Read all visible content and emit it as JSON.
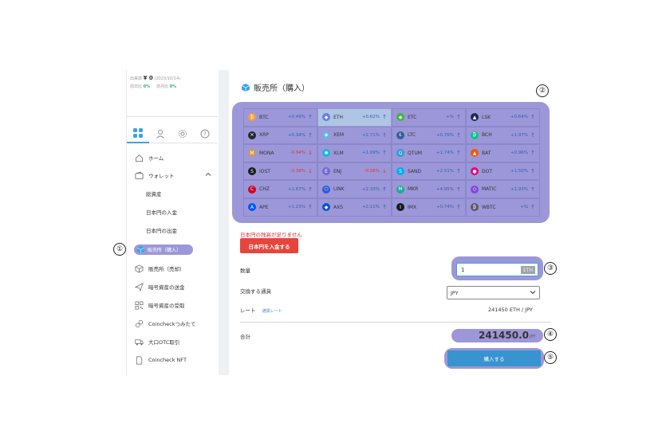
{
  "summary": {
    "label": "出来高",
    "amount": "¥ 0",
    "date": "(2023/10/14)",
    "change_label_1": "前日比",
    "change_value_1": "0%",
    "change_label_2": "前月比",
    "change_value_2": "0%"
  },
  "tabs": [
    "grid",
    "user",
    "gear",
    "help"
  ],
  "sidebar": {
    "home": "ホーム",
    "wallet": "ウォレット",
    "sub_total": "総資産",
    "sub_deposit": "日本円の入金",
    "sub_withdraw": "日本円の出金",
    "buy": "販売所（購入）",
    "sell": "販売所（売却）",
    "send": "暗号資産の送金",
    "receive": "暗号資産の受取",
    "tsumitate": "Coincheckつみたて",
    "otc": "大口OTC取引",
    "nft": "Coincheck NFT"
  },
  "markers": [
    "①",
    "②",
    "③",
    "④",
    "⑤"
  ],
  "main": {
    "title": "販売所（購入）",
    "coins": [
      {
        "sym": "BTC",
        "pct": "+0.49%",
        "dir": "up",
        "color": "#f0a03a",
        "glyph": "₿"
      },
      {
        "sym": "ETH",
        "pct": "+0.62%",
        "dir": "up",
        "color": "#627eea",
        "glyph": "◆"
      },
      {
        "sym": "ETC",
        "pct": "+%",
        "dir": "up",
        "color": "#3ab83a",
        "glyph": "◆"
      },
      {
        "sym": "LSK",
        "pct": "+0.64%",
        "dir": "up",
        "color": "#1a2a5a",
        "glyph": "▲"
      },
      {
        "sym": "XRP",
        "pct": "+0.34%",
        "dir": "up",
        "color": "#23292f",
        "glyph": "✕"
      },
      {
        "sym": "XEM",
        "pct": "+2.71%",
        "dir": "up",
        "color": "#67b2e8",
        "glyph": "◈"
      },
      {
        "sym": "LTC",
        "pct": "+0.76%",
        "dir": "up",
        "color": "#345d9d",
        "glyph": "Ł"
      },
      {
        "sym": "BCH",
        "pct": "+1.97%",
        "dir": "up",
        "color": "#0ac18e",
        "glyph": "₿"
      },
      {
        "sym": "MONA",
        "pct": "-0.94%",
        "dir": "down",
        "color": "#c99a5b",
        "glyph": "M"
      },
      {
        "sym": "XLM",
        "pct": "+1.09%",
        "dir": "up",
        "color": "#14b6e7",
        "glyph": "✺"
      },
      {
        "sym": "QTUM",
        "pct": "+1.74%",
        "dir": "up",
        "color": "#2e9ad0",
        "glyph": "Q"
      },
      {
        "sym": "BAT",
        "pct": "+0.96%",
        "dir": "up",
        "color": "#ff5000",
        "glyph": "▲"
      },
      {
        "sym": "IOST",
        "pct": "-3.39%",
        "dir": "down",
        "color": "#1c1c1c",
        "glyph": "S"
      },
      {
        "sym": "ENJ",
        "pct": "-0.06%",
        "dir": "down",
        "color": "#7866d5",
        "glyph": "E"
      },
      {
        "sym": "SAND",
        "pct": "+2.51%",
        "dir": "up",
        "color": "#00adef",
        "glyph": "S"
      },
      {
        "sym": "DOT",
        "pct": "+1.50%",
        "dir": "up",
        "color": "#e6007a",
        "glyph": "●"
      },
      {
        "sym": "CHZ",
        "pct": "+1.67%",
        "dir": "up",
        "color": "#cd0124",
        "glyph": "C"
      },
      {
        "sym": "LINK",
        "pct": "+2.33%",
        "dir": "up",
        "color": "#2a5ada",
        "glyph": "⬡"
      },
      {
        "sym": "MKR",
        "pct": "+4.95%",
        "dir": "up",
        "color": "#1aab9b",
        "glyph": "M"
      },
      {
        "sym": "MATIC",
        "pct": "+1.93%",
        "dir": "up",
        "color": "#8247e5",
        "glyph": "◇"
      },
      {
        "sym": "APE",
        "pct": "+1.23%",
        "dir": "up",
        "color": "#0054f9",
        "glyph": "A"
      },
      {
        "sym": "AXS",
        "pct": "+2.11%",
        "dir": "up",
        "color": "#0055d5",
        "glyph": "◆"
      },
      {
        "sym": "IMX",
        "pct": "+0.74%",
        "dir": "up",
        "color": "#17191e",
        "glyph": "I"
      },
      {
        "sym": "WBTC",
        "pct": "+%",
        "dir": "up",
        "color": "#5a5564",
        "glyph": "₿"
      }
    ],
    "warning": "日本円の残高が足りません",
    "deposit_button": "日本円を入金する",
    "quantity_label": "数量",
    "quantity_value": "1",
    "quantity_unit": "ETH",
    "exchange_label": "交換する通貨",
    "exchange_value": "JPY",
    "rate_label": "レート",
    "rate_link": "通貨レート",
    "rate_value": "241450  ETH / JPY",
    "total_label": "合計",
    "total_value": "241450.0",
    "total_unit": "JPY",
    "buy_button": "購入する"
  }
}
